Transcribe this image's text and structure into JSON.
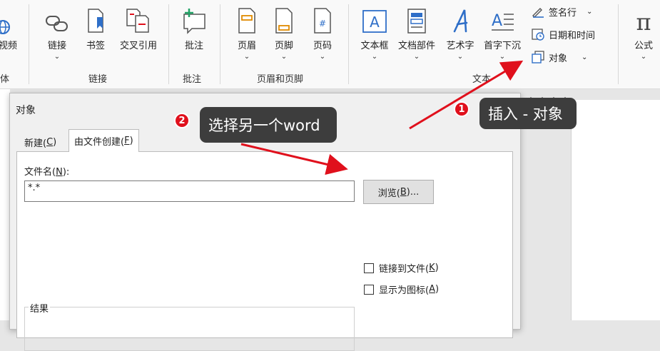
{
  "ribbon": {
    "partial_left_label": "视频",
    "partial_left_group": "体",
    "links_group": {
      "label": "链接",
      "buttons": [
        {
          "label": "链接",
          "icon": "link-icon",
          "has_dropdown": true
        },
        {
          "label": "书签",
          "icon": "bookmark-icon",
          "has_dropdown": false
        },
        {
          "label": "交叉引用",
          "icon": "cross-reference-icon",
          "has_dropdown": false
        }
      ]
    },
    "comments_group": {
      "label": "批注",
      "buttons": [
        {
          "label": "批注",
          "icon": "comment-icon"
        }
      ]
    },
    "header_footer_group": {
      "label": "页眉和页脚",
      "buttons": [
        {
          "label": "页眉",
          "icon": "header-icon"
        },
        {
          "label": "页脚",
          "icon": "footer-icon"
        },
        {
          "label": "页码",
          "icon": "page-number-icon",
          "glyph": "#"
        }
      ]
    },
    "text_group": {
      "label": "文本",
      "buttons": [
        {
          "label": "文本框",
          "icon": "text-box-icon",
          "glyph": "A"
        },
        {
          "label": "文档部件",
          "icon": "quick-parts-icon"
        },
        {
          "label": "艺术字",
          "icon": "wordart-icon",
          "glyph": "A"
        },
        {
          "label": "首字下沉",
          "icon": "drop-cap-icon",
          "glyph": "A"
        }
      ],
      "small_buttons": [
        {
          "label": "签名行",
          "icon": "signature-line-icon",
          "has_dropdown": true
        },
        {
          "label": "日期和时间",
          "icon": "date-time-icon",
          "has_dropdown": false
        },
        {
          "label": "对象",
          "icon": "object-icon",
          "has_dropdown": true
        }
      ]
    },
    "symbols_group": {
      "buttons": [
        {
          "label": "公式",
          "icon": "equation-icon",
          "glyph": "π"
        }
      ]
    },
    "colors": {
      "accent": "#2b579a",
      "icon_blue": "#2f6fc8",
      "icon_gray": "#555555"
    }
  },
  "dialog": {
    "title": "对象",
    "tabs": [
      {
        "label_prefix": "新建(",
        "mnemonic": "C",
        "label_suffix": ")",
        "active": false
      },
      {
        "label_prefix": "由文件创建(",
        "mnemonic": "F",
        "label_suffix": ")",
        "active": true
      }
    ],
    "filename_label_prefix": "文件名(",
    "filename_mnemonic": "N",
    "filename_label_suffix": "):",
    "filename_value": "*.*",
    "browse_prefix": "浏览(",
    "browse_mnemonic": "B",
    "browse_suffix": ")...",
    "checkboxes": [
      {
        "prefix": "链接到文件(",
        "mnemonic": "K",
        "suffix": ")",
        "checked": false
      },
      {
        "prefix": "显示为图标(",
        "mnemonic": "A",
        "suffix": ")",
        "checked": false
      }
    ],
    "result_label": "结果"
  },
  "annotations": [
    {
      "number": "1",
      "text": "插入 - 对象"
    },
    {
      "number": "2",
      "text": "选择另一个word"
    }
  ],
  "colors": {
    "callout_bg": "#3d3d3d",
    "badge": "#e0101c",
    "arrow": "#e0101c"
  }
}
